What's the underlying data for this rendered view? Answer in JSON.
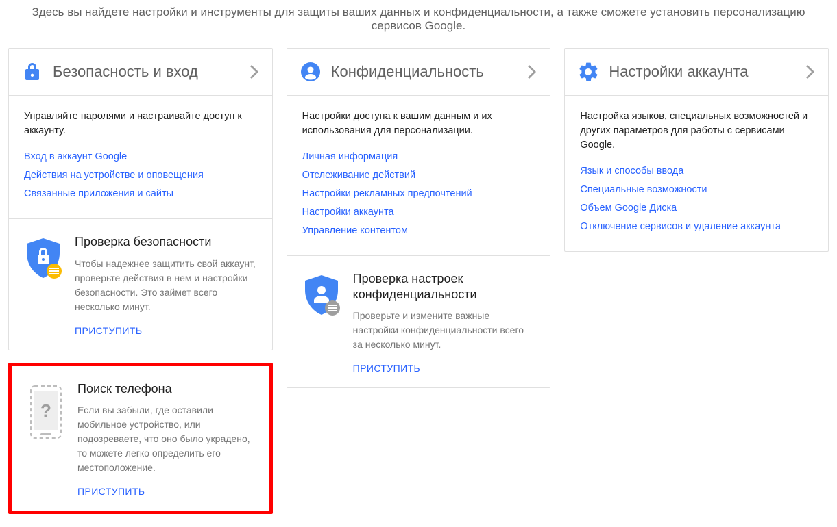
{
  "intro": "Здесь вы найдете настройки и инструменты для защиты ваших данных и конфиденциальности, а также сможете установить персонализацию сервисов Google.",
  "columns": {
    "security": {
      "title": "Безопасность и вход",
      "desc": "Управляйте паролями и настраивайте доступ к аккаунту.",
      "links": [
        "Вход в аккаунт Google",
        "Действия на устройстве и оповещения",
        "Связанные приложения и сайты"
      ],
      "checkup": {
        "title": "Проверка безопасности",
        "desc": "Чтобы надежнее защитить свой аккаунт, проверьте действия в нем и настройки безопасности. Это займет всего несколько минут.",
        "action": "ПРИСТУПИТЬ"
      },
      "findphone": {
        "title": "Поиск телефона",
        "desc": "Если вы забыли, где оставили мобильное устройство, или подозреваете, что оно было украдено, то можете легко определить его местоположение.",
        "action": "ПРИСТУПИТЬ"
      }
    },
    "privacy": {
      "title": "Конфиденциальность",
      "desc": "Настройки доступа к вашим данным и их использования для персонализации.",
      "links": [
        "Личная информация",
        "Отслеживание действий",
        "Настройки рекламных предпочтений",
        "Настройки аккаунта",
        "Управление контентом"
      ],
      "checkup": {
        "title": "Проверка настроек конфиденциальности",
        "desc": "Проверьте и измените важные настройки конфиденциальности всего за несколько минут.",
        "action": "ПРИСТУПИТЬ"
      }
    },
    "account": {
      "title": "Настройки аккаунта",
      "desc": "Настройка языков, специальных возможностей и других параметров для работы с сервисами Google.",
      "links": [
        "Язык и способы ввода",
        "Специальные возможности",
        "Объем Google Диска",
        "Отключение сервисов и удаление аккаунта"
      ]
    }
  }
}
